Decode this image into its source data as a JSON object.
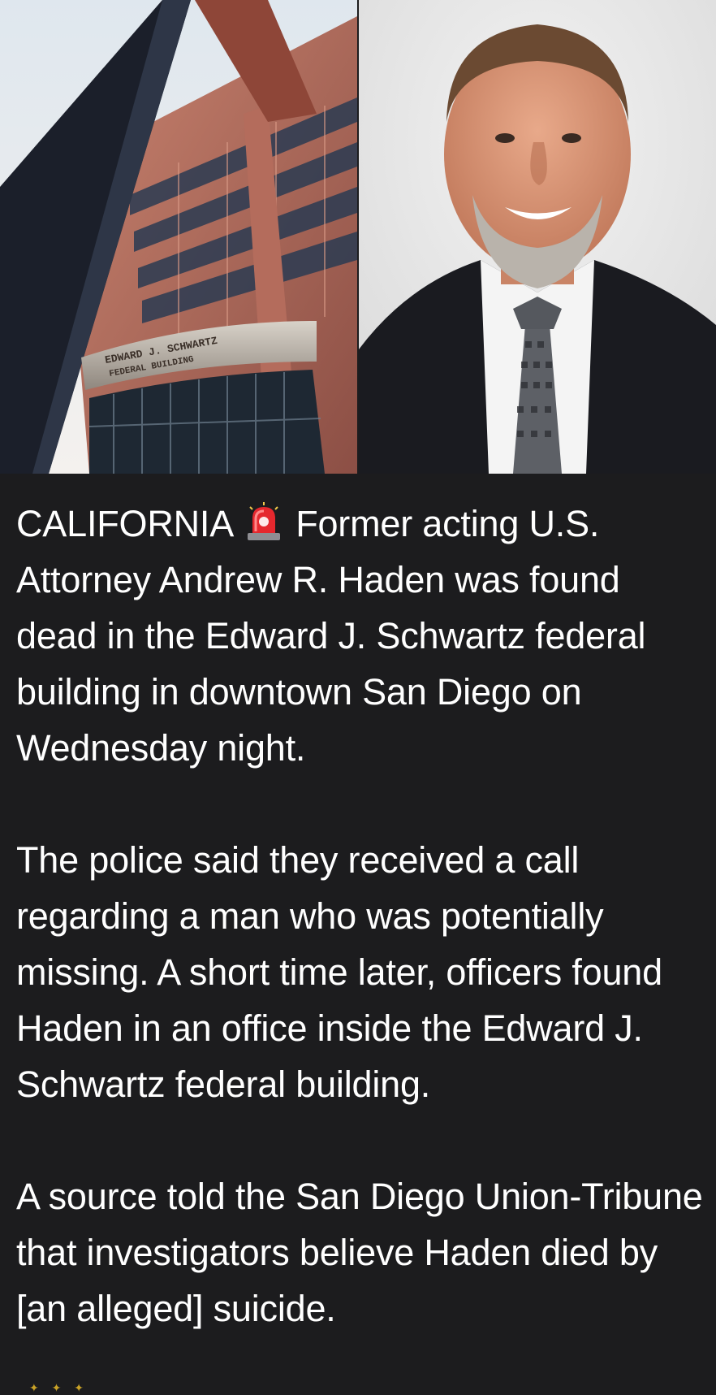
{
  "images": {
    "building_photo": {
      "sign_line1": "EDWARD J. SCHWARTZ",
      "sign_line2": "FEDERAL BUILDING"
    },
    "portrait_photo": {}
  },
  "post": {
    "icon": "police-siren-emoji",
    "lead_prefix": "CALIFORNIA",
    "paragraph1_rest": "Former acting U.S. Attorney Andrew R. Haden was found dead in the Edward J. Schwartz federal building in downtown San Diego on Wednesday night.",
    "paragraph2": "The police said they received a call regarding a man who was potentially missing. A short time later, officers found Haden in an office inside the Edward J. Schwartz federal building.",
    "paragraph3": "A source told the San Diego Union-Tribune that investigators believe Haden died by [an alleged] suicide."
  },
  "colors": {
    "background": "#1c1c1e",
    "text": "#ffffff"
  }
}
